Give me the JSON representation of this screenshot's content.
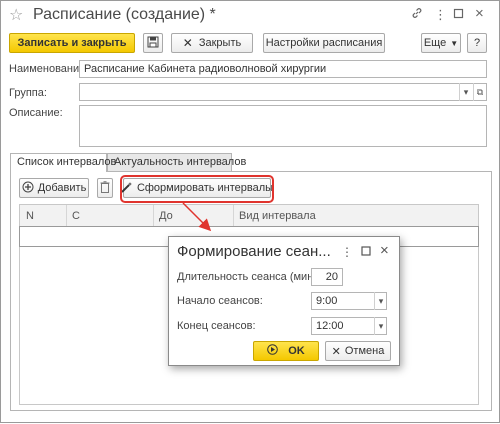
{
  "window": {
    "title": "Расписание (создание) *",
    "icons": {
      "star": "star-icon",
      "link": "link-icon",
      "more": "more-vert-icon",
      "maximize": "maximize-icon",
      "close": "close-icon"
    }
  },
  "toolbar": {
    "save_close_label": "Записать и закрыть",
    "close_label": "Закрыть",
    "settings_label": "Настройки расписания",
    "more_label": "Еще",
    "help_label": "?"
  },
  "form": {
    "name_label": "Наименование:",
    "name_value": "Расписание Кабинета радиоволновой хирургии",
    "group_label": "Группа:",
    "group_value": "",
    "description_label": "Описание:",
    "description_value": ""
  },
  "tabs": [
    {
      "label": "Список интервалов",
      "active": true
    },
    {
      "label": "Актуальность интервалов",
      "active": false
    }
  ],
  "tab_toolbar": {
    "add_label": "Добавить",
    "generate_label": "Сформировать интервалы"
  },
  "grid": {
    "columns": [
      "N",
      "С",
      "До",
      "Вид интервала"
    ],
    "rows": []
  },
  "dialog": {
    "title": "Формирование сеан...",
    "duration_label": "Длительность сеанса (минут):",
    "duration_value": "20",
    "start_label": "Начало сеансов:",
    "start_value": "9:00",
    "end_label": "Конец сеансов:",
    "end_value": "12:00",
    "ok_label": "OK",
    "cancel_label": "Отмена"
  },
  "colors": {
    "accent_yellow": "#f4c800",
    "highlight_red": "#e0342e"
  }
}
